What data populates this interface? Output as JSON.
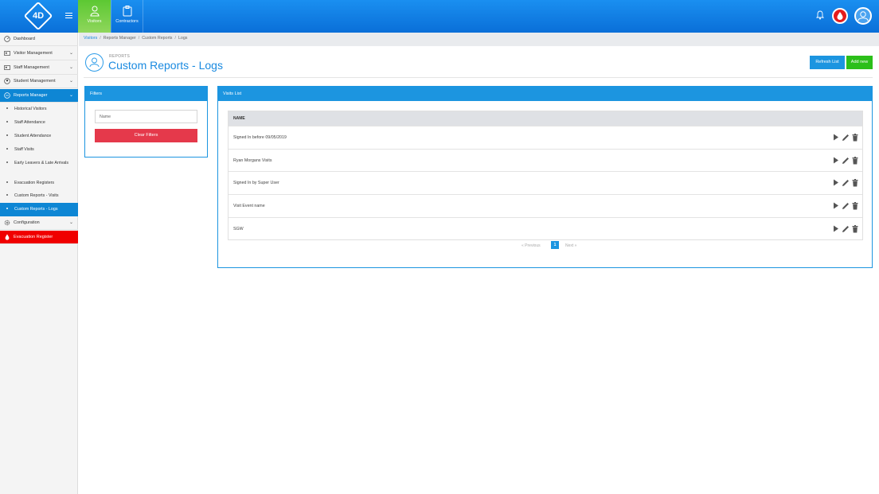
{
  "app": {
    "logo_text": "4D"
  },
  "topnav": {
    "tabs": [
      {
        "label": "Visitors",
        "active": true
      },
      {
        "label": "Contractors",
        "active": false
      }
    ]
  },
  "sidebar": {
    "items": [
      {
        "label": "Dashboard",
        "icon": "dashboard-icon"
      },
      {
        "label": "Visitor Management",
        "icon": "visitor-icon"
      },
      {
        "label": "Staff Management",
        "icon": "staff-icon"
      },
      {
        "label": "Student Management",
        "icon": "student-icon"
      },
      {
        "label": "Reports Manager",
        "icon": "reports-icon"
      },
      {
        "label": "Configuration",
        "icon": "gear-icon"
      },
      {
        "label": "Evacuation Register",
        "icon": "drop-icon"
      }
    ],
    "reports_sub": [
      {
        "label": "Historical Visitors"
      },
      {
        "label": "Staff Attendance"
      },
      {
        "label": "Student Attendance"
      },
      {
        "label": "Staff Visits"
      },
      {
        "label": "Early Leavers & Late Arrivals"
      },
      {
        "label": "Evacuation Registers"
      },
      {
        "label": "Custom Reports - Visits"
      },
      {
        "label": "Custom Reports - Logs"
      }
    ]
  },
  "breadcrumb": {
    "items": [
      "Visitors",
      "Reports Manager",
      "Custom Reports",
      "Logs"
    ]
  },
  "header": {
    "subtitle": "REPORTS",
    "title": "Custom Reports - Logs",
    "refresh_label": "Refresh List",
    "add_label": "Add new"
  },
  "filters": {
    "title": "Filters",
    "name_placeholder": "Name",
    "clear_label": "Clear Filters"
  },
  "visits": {
    "title": "Visits List",
    "column": "NAME",
    "rows": [
      "Signed In before 09/05/2019",
      "Ryan Morgans Visits",
      "Signed In by Super User",
      "Visit Event name",
      "SGW"
    ]
  },
  "pagination": {
    "prev": "« Previous",
    "page": "1",
    "next": "Next »"
  },
  "colors": {
    "primary": "#1c95e0",
    "success": "#2cbf1a",
    "danger": "#e5394b",
    "evac": "#f00000"
  }
}
